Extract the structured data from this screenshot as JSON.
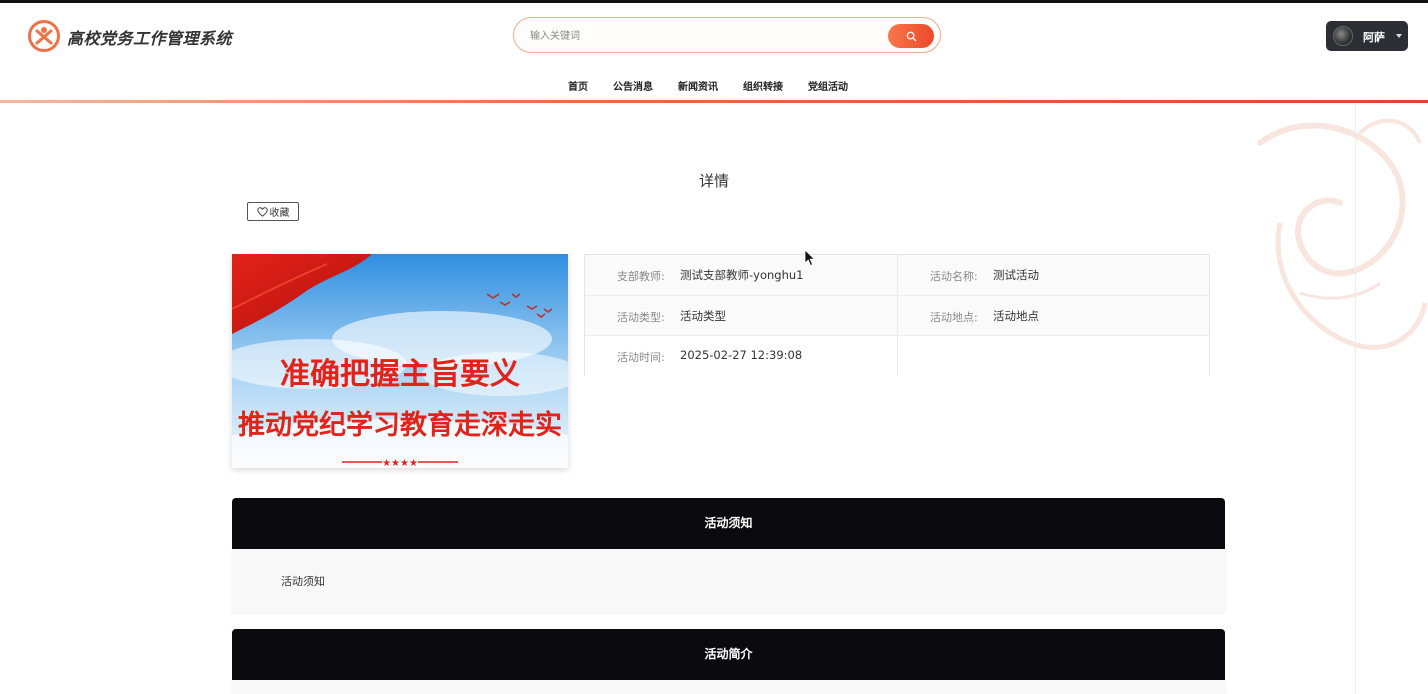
{
  "header": {
    "site_title": "高校党务工作管理系统",
    "search_placeholder": "输入关键词",
    "user_name": "阿萨"
  },
  "nav": [
    {
      "label": "首页"
    },
    {
      "label": "公告消息"
    },
    {
      "label": "新闻资讯"
    },
    {
      "label": "组织转接"
    },
    {
      "label": "党组活动"
    }
  ],
  "page": {
    "title": "详情",
    "favorite_label": "收藏"
  },
  "banner": {
    "line1": "准确把握主旨要义",
    "line2": "推动党纪学习教育走深走实"
  },
  "info": {
    "branch_teacher_label": "支部教师:",
    "branch_teacher_value": "测试支部教师-yonghu1",
    "activity_name_label": "活动名称:",
    "activity_name_value": "测试活动",
    "activity_type_label": "活动类型:",
    "activity_type_value": "活动类型",
    "activity_place_label": "活动地点:",
    "activity_place_value": "活动地点",
    "activity_time_label": "活动时间:",
    "activity_time_value": "2025-02-27 12:39:08"
  },
  "sections": [
    {
      "title": "活动须知",
      "content": "活动须知"
    },
    {
      "title": "活动简介",
      "content": ""
    }
  ],
  "colors": {
    "accent": "#f26b3a",
    "section_header": "#0a0a0f",
    "user_button": "#2b2e33"
  }
}
